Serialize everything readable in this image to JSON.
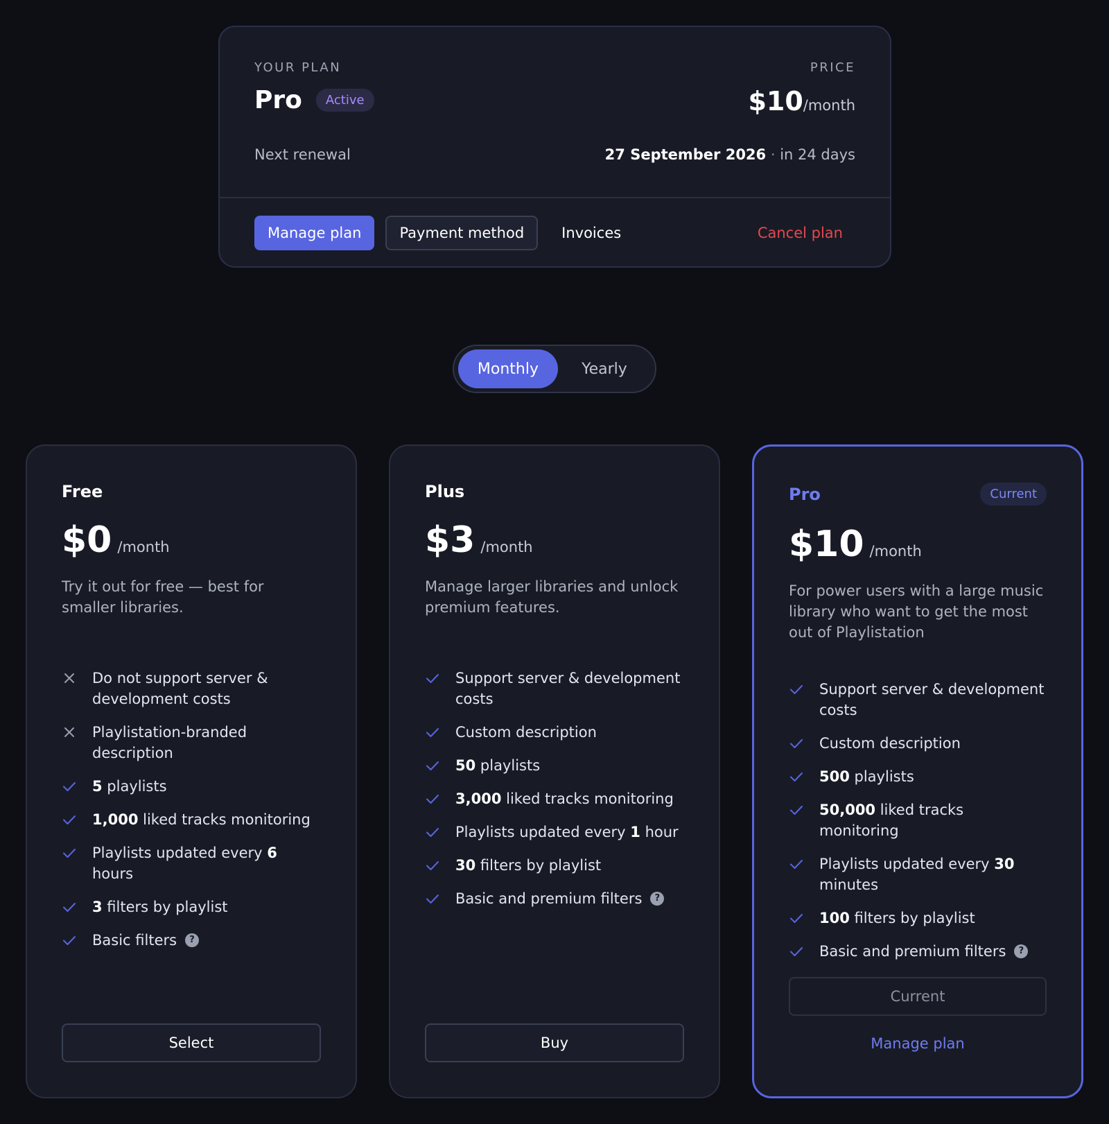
{
  "plan": {
    "eyebrow": "YOUR PLAN",
    "name": "Pro",
    "status": "Active",
    "price_eyebrow": "PRICE",
    "price": "$10",
    "price_unit": "/month",
    "renewal_label": "Next renewal",
    "renewal_date": "27 September 2026",
    "renewal_sep": " · ",
    "renewal_relative": "in 24 days",
    "actions": {
      "manage": "Manage plan",
      "payment": "Payment method",
      "invoices": "Invoices",
      "cancel": "Cancel plan"
    }
  },
  "billing_toggle": {
    "monthly": "Monthly",
    "yearly": "Yearly",
    "selected": "Monthly"
  },
  "tiers": [
    {
      "name": "Free",
      "price": "$0",
      "unit": "/month",
      "description": "Try it out for free — best for smaller libraries.",
      "features": [
        {
          "icon": "x",
          "pre": "",
          "bold": "",
          "post": "Do not support server & development costs"
        },
        {
          "icon": "x",
          "pre": "",
          "bold": "",
          "post": "Playlistation-branded description"
        },
        {
          "icon": "check",
          "pre": "",
          "bold": "5",
          "post": " playlists"
        },
        {
          "icon": "check",
          "pre": "",
          "bold": "1,000",
          "post": " liked tracks monitoring"
        },
        {
          "icon": "check",
          "pre": "Playlists updated every ",
          "bold": "6",
          "post": " hours"
        },
        {
          "icon": "check",
          "pre": "",
          "bold": "3",
          "post": " filters by playlist"
        },
        {
          "icon": "check",
          "pre": "",
          "bold": "",
          "post": "Basic filters",
          "help": true
        }
      ],
      "button": "Select"
    },
    {
      "name": "Plus",
      "price": "$3",
      "unit": "/month",
      "description": "Manage larger libraries and unlock premium features.",
      "features": [
        {
          "icon": "check",
          "pre": "",
          "bold": "",
          "post": "Support server & development costs"
        },
        {
          "icon": "check",
          "pre": "",
          "bold": "",
          "post": "Custom description"
        },
        {
          "icon": "check",
          "pre": "",
          "bold": "50",
          "post": " playlists"
        },
        {
          "icon": "check",
          "pre": "",
          "bold": "3,000",
          "post": " liked tracks monitoring"
        },
        {
          "icon": "check",
          "pre": "Playlists updated every ",
          "bold": "1",
          "post": " hour"
        },
        {
          "icon": "check",
          "pre": "",
          "bold": "30",
          "post": " filters by playlist"
        },
        {
          "icon": "check",
          "pre": "",
          "bold": "",
          "post": "Basic and premium filters",
          "help": true
        }
      ],
      "button": "Buy"
    },
    {
      "name": "Pro",
      "badge": "Current",
      "price": "$10",
      "unit": "/month",
      "description": "For power users with a large music library who want to get the most out of Playlistation",
      "features": [
        {
          "icon": "check",
          "pre": "",
          "bold": "",
          "post": "Support server & development costs"
        },
        {
          "icon": "check",
          "pre": "",
          "bold": "",
          "post": "Custom description"
        },
        {
          "icon": "check",
          "pre": "",
          "bold": "500",
          "post": " playlists"
        },
        {
          "icon": "check",
          "pre": "",
          "bold": "50,000",
          "post": " liked tracks monitoring"
        },
        {
          "icon": "check",
          "pre": "Playlists updated every ",
          "bold": "30",
          "post": " minutes"
        },
        {
          "icon": "check",
          "pre": "",
          "bold": "100",
          "post": " filters by playlist"
        },
        {
          "icon": "check",
          "pre": "",
          "bold": "",
          "post": "Basic and premium filters",
          "help": true
        }
      ],
      "button": "Current",
      "link": "Manage plan"
    }
  ],
  "colors": {
    "accent": "#5865e0",
    "danger": "#e5484d",
    "active_badge": "#a78bfa",
    "background": "#0e0f15",
    "card": "#181b26"
  }
}
